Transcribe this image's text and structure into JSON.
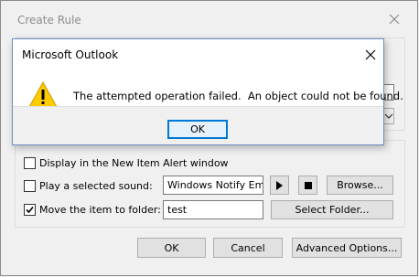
{
  "create_rule": {
    "title": "Create Rule",
    "options": {
      "alert_window": {
        "label": "Display in the New Item Alert window",
        "checked": false
      },
      "play_sound": {
        "label": "Play a selected sound:",
        "checked": false,
        "value": "Windows Notify Em",
        "browse_label": "Browse..."
      },
      "move_folder": {
        "label": "Move the item to folder:",
        "checked": true,
        "value": "test",
        "select_label": "Select Folder..."
      }
    },
    "buttons": {
      "ok": "OK",
      "cancel": "Cancel",
      "advanced": "Advanced Options..."
    }
  },
  "message_box": {
    "title": "Microsoft Outlook",
    "icon": "warning-icon",
    "message": "The attempted operation failed.  An object could not be found.",
    "ok_label": "OK"
  },
  "colors": {
    "warning_fill": "#ffcc00",
    "focus_border": "#0078d7",
    "dialog_bg": "#f0f0f0"
  }
}
